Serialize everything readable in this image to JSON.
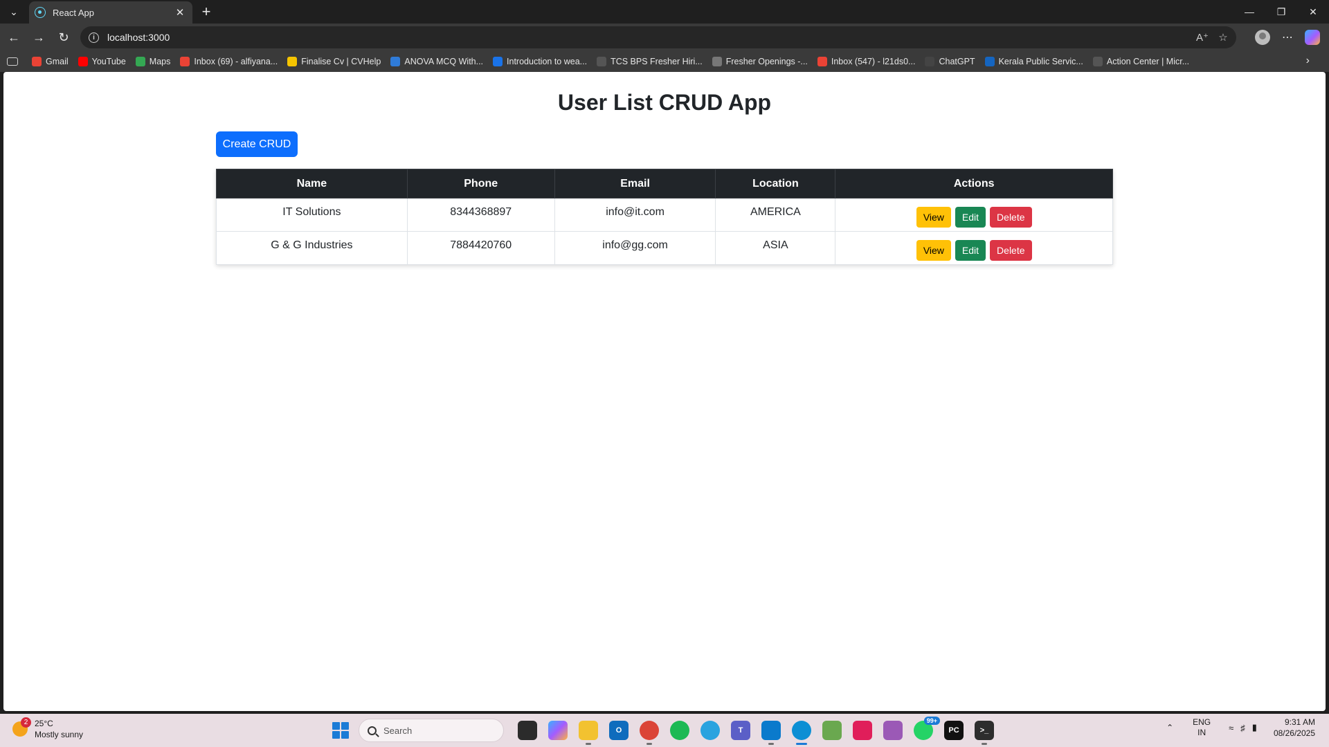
{
  "browser": {
    "tab_title": "React App",
    "url": "localhost:3000",
    "bookmarks": [
      {
        "label": "Gmail",
        "icon": "gmail-icon",
        "color": "#ea4335"
      },
      {
        "label": "YouTube",
        "icon": "youtube-icon",
        "color": "#ff0000"
      },
      {
        "label": "Maps",
        "icon": "maps-icon",
        "color": "#34a853"
      },
      {
        "label": "Inbox (69) - alfiyana...",
        "icon": "gmail-icon",
        "color": "#ea4335"
      },
      {
        "label": "Finalise Cv | CVHelp",
        "icon": "cvhelp-icon",
        "color": "#f5c400"
      },
      {
        "label": "ANOVA MCQ With...",
        "icon": "sanfoundry-icon",
        "color": "#2f7bd8"
      },
      {
        "label": "Introduction to wea...",
        "icon": "globe-icon",
        "color": "#1a73e8"
      },
      {
        "label": "TCS BPS Fresher Hiri...",
        "icon": "tcs-icon",
        "color": "#555555"
      },
      {
        "label": "Fresher Openings -...",
        "icon": "page-icon",
        "color": "#777777"
      },
      {
        "label": "Inbox (547) - l21ds0...",
        "icon": "gmail-icon",
        "color": "#ea4335"
      },
      {
        "label": "ChatGPT",
        "icon": "chatgpt-icon",
        "color": "#444444"
      },
      {
        "label": "Kerala Public Servic...",
        "icon": "kpsc-icon",
        "color": "#1565c0"
      },
      {
        "label": "Action Center | Micr...",
        "icon": "globe-icon",
        "color": "#555555"
      }
    ]
  },
  "page": {
    "title": "User List CRUD App",
    "create_button": "Create CRUD",
    "table": {
      "headers": [
        "Name",
        "Phone",
        "Email",
        "Location",
        "Actions"
      ],
      "rows": [
        {
          "name": "IT Solutions",
          "phone": "8344368897",
          "email": "info@it.com",
          "location": "AMERICA"
        },
        {
          "name": "G & G Industries",
          "phone": "7884420760",
          "email": "info@gg.com",
          "location": "ASIA"
        }
      ],
      "actions": {
        "view": "View",
        "edit": "Edit",
        "delete": "Delete"
      }
    }
  },
  "taskbar": {
    "weather_temp": "25°C",
    "weather_desc": "Mostly sunny",
    "weather_badge": "2",
    "search_placeholder": "Search",
    "whatsapp_badge": "99+",
    "lang_top": "ENG",
    "lang_bottom": "IN",
    "time": "9:31 AM",
    "date": "08/26/2025"
  },
  "colors": {
    "primary": "#0d6efd",
    "warning": "#ffc107",
    "success": "#198754",
    "danger": "#dc3545",
    "table_header": "#212529"
  }
}
